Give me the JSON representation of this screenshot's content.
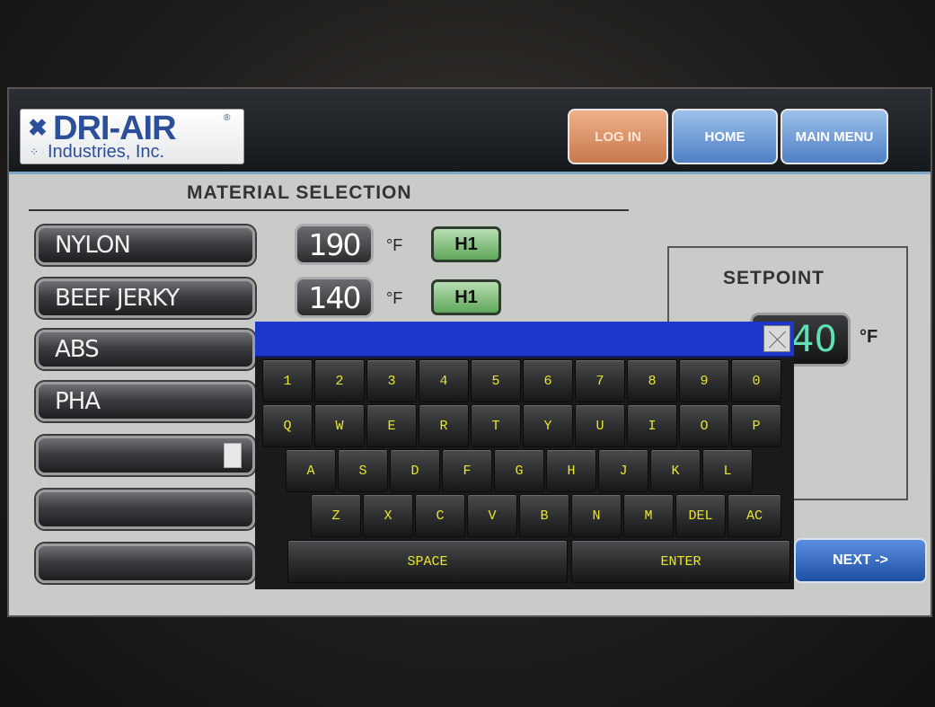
{
  "header": {
    "logo": {
      "title": "DRI-AIR",
      "reg": "®",
      "subtitle": "Industries, Inc."
    },
    "buttons": {
      "login": "LOG IN",
      "home": "HOME",
      "main_menu": "MAIN MENU"
    }
  },
  "page": {
    "title": "MATERIAL SELECTION",
    "materials": [
      {
        "name": "NYLON",
        "temp": "190",
        "unit": "°F",
        "heater": "H1"
      },
      {
        "name": "BEEF JERKY",
        "temp": "140",
        "unit": "°F",
        "heater": "H1"
      },
      {
        "name": "ABS"
      },
      {
        "name": "PHA"
      },
      {
        "name": ""
      },
      {
        "name": ""
      },
      {
        "name": ""
      }
    ],
    "setpoint": {
      "label": "SETPOINT",
      "value": "40",
      "unit": "°F"
    },
    "next": "NEXT ->"
  },
  "keyboard": {
    "input_value": "",
    "row_numbers": [
      "1",
      "2",
      "3",
      "4",
      "5",
      "6",
      "7",
      "8",
      "9",
      "0"
    ],
    "row_top": [
      "Q",
      "W",
      "E",
      "R",
      "T",
      "Y",
      "U",
      "I",
      "O",
      "P"
    ],
    "row_home": [
      "A",
      "S",
      "D",
      "F",
      "G",
      "H",
      "J",
      "K",
      "L"
    ],
    "row_bottom": [
      "Z",
      "X",
      "C",
      "V",
      "B",
      "N",
      "M",
      "DEL",
      "AC"
    ],
    "space": "SPACE",
    "enter": "ENTER"
  },
  "colors": {
    "header_bg": "#1d2023",
    "screen_bg": "#c9cbc8",
    "login_btn": "#d99468",
    "nav_btn": "#6a96d6",
    "heater_badge": "#84c27e",
    "setpoint_text": "#5fe0b6",
    "key_text": "#e9e62b",
    "kbd_input_bar": "#1f36cc"
  }
}
